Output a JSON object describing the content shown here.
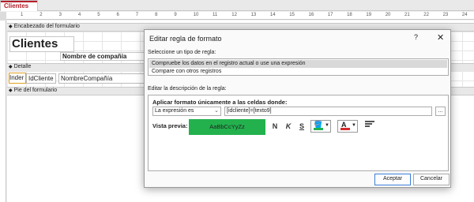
{
  "tabs": [
    {
      "label": "Clientes"
    }
  ],
  "ruler": {
    "ticks": [
      "1",
      "2",
      "3",
      "4",
      "5",
      "6",
      "7",
      "8",
      "9",
      "10",
      "11",
      "12",
      "13",
      "14",
      "15",
      "16",
      "17",
      "18",
      "19",
      "20",
      "21",
      "22",
      "23",
      "24"
    ]
  },
  "form": {
    "sections": {
      "header": "Encabezado del formulario",
      "detail": "Detalle",
      "footer": "Pie del formulario"
    },
    "controls": {
      "title_label": "Clientes",
      "nombre_header_label": "Nombre de compañía",
      "inde_label": "Inder",
      "idcliente_field": "IdCliente",
      "nombre_field": "NombreCompañía"
    }
  },
  "dialog": {
    "title": "Editar regla de formato",
    "help": "?",
    "close": "✕",
    "rule_type_label": "Seleccione un tipo de regla:",
    "rule_types": [
      "Compruebe los datos en el registro actual o use una expresión",
      "Compare con otros registros"
    ],
    "selected_rule_index": 0,
    "edit_desc_label": "Editar la descripción de la regla:",
    "apply_label": "Aplicar formato únicamente a las celdas donde:",
    "condition_select": "La expresión es",
    "expression": "[idcliente]=[texto9]",
    "builder_label": "...",
    "preview_label": "Vista previa:",
    "preview_text": "AaBbCcYyZz",
    "preview_bg": "#23b14d",
    "bold_label": "N",
    "italic_label": "K",
    "underline_label": "S",
    "fill_color": "#23b14d",
    "font_color": "#d62a2a",
    "font_letter": "A",
    "accept_label": "Aceptar",
    "cancel_label": "Cancelar"
  }
}
